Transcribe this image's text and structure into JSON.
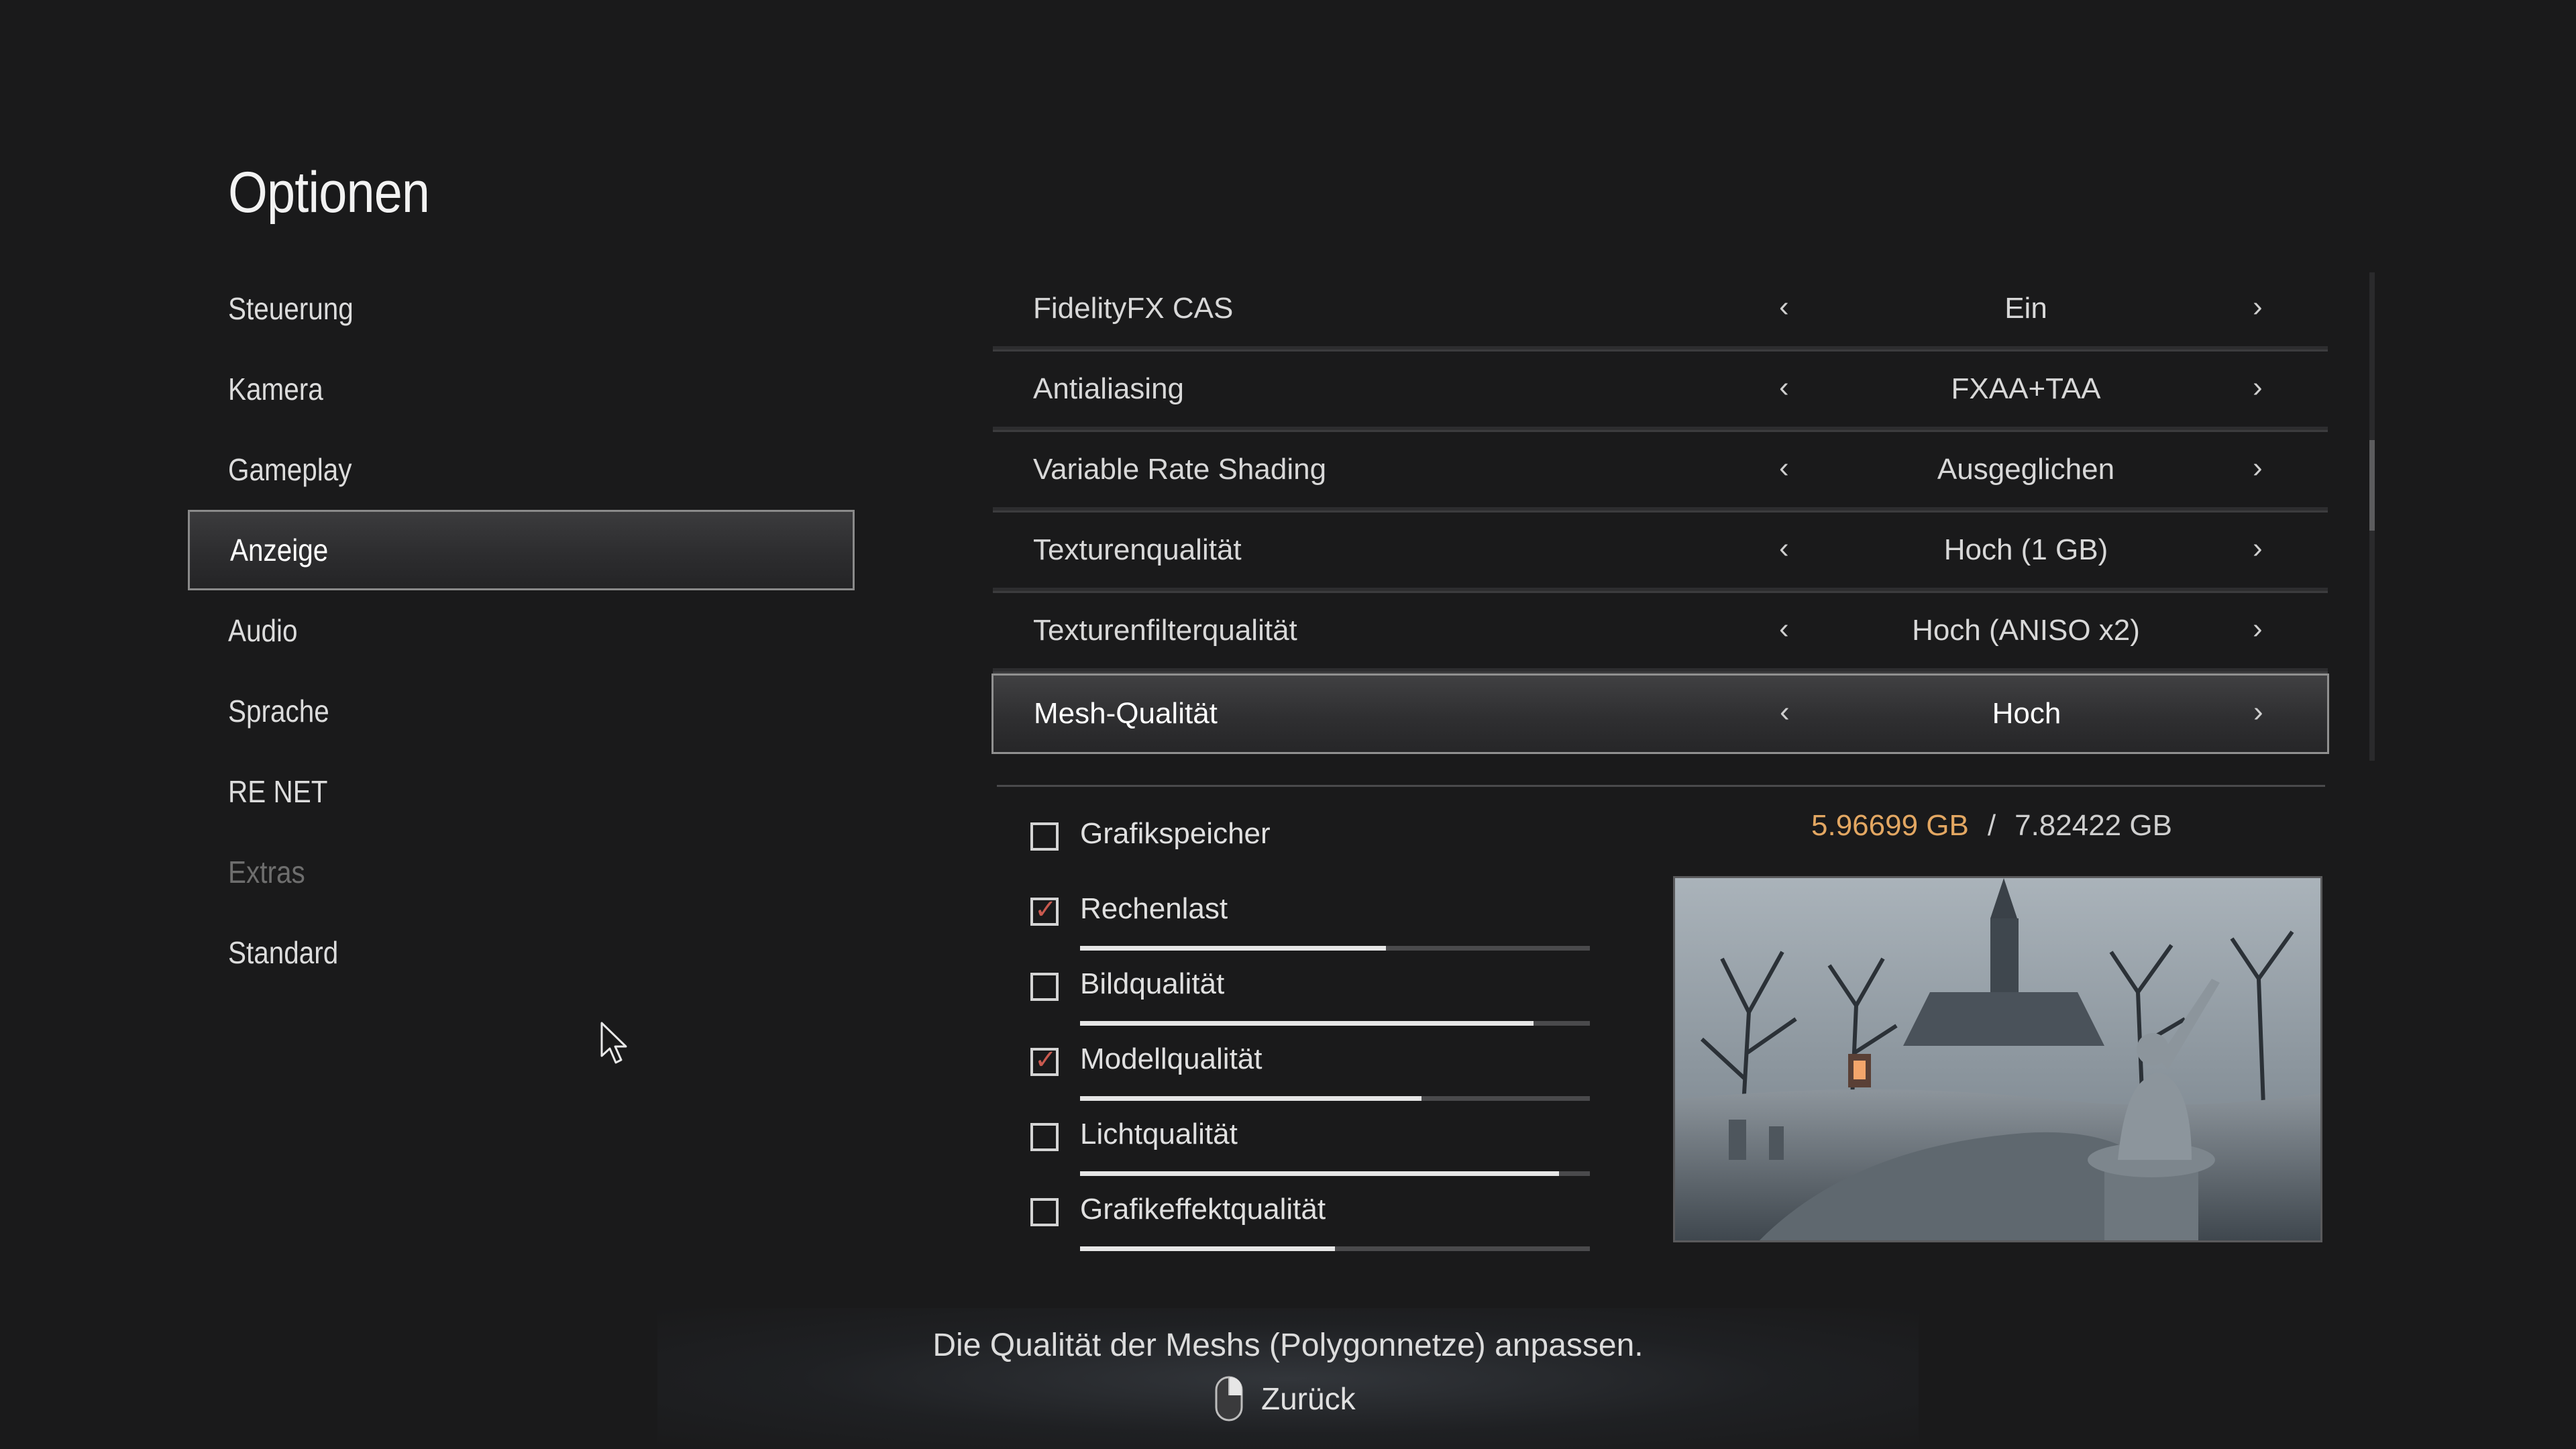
{
  "title": "Optionen",
  "menu": [
    {
      "label": "Steuerung",
      "state": "normal"
    },
    {
      "label": "Kamera",
      "state": "normal"
    },
    {
      "label": "Gameplay",
      "state": "normal"
    },
    {
      "label": "Anzeige",
      "state": "active"
    },
    {
      "label": "Audio",
      "state": "normal"
    },
    {
      "label": "Sprache",
      "state": "normal"
    },
    {
      "label": "RE NET",
      "state": "normal"
    },
    {
      "label": "Extras",
      "state": "disabled"
    },
    {
      "label": "Standard",
      "state": "normal"
    }
  ],
  "settings": [
    {
      "label": "FidelityFX CAS",
      "value": "Ein"
    },
    {
      "label": "Antialiasing",
      "value": "FXAA+TAA"
    },
    {
      "label": "Variable Rate Shading",
      "value": "Ausgeglichen"
    },
    {
      "label": "Texturenqualität",
      "value": "Hoch (1 GB)"
    },
    {
      "label": "Texturenfilterqualität",
      "value": "Hoch (ANISO x2)"
    },
    {
      "label": "Mesh-Qualität",
      "value": "Hoch",
      "active": true
    }
  ],
  "arrows": {
    "left": "‹",
    "right": "›"
  },
  "scrollbar": {
    "position": 0.34
  },
  "vram": {
    "label": "Grafikspeicher",
    "used": "5.96699 GB",
    "separator": "/",
    "total": "7.82422 GB",
    "checked": false
  },
  "metrics": [
    {
      "label": "Rechenlast",
      "checked": true,
      "level": 0.6
    },
    {
      "label": "Bildqualität",
      "checked": false,
      "level": 0.89
    },
    {
      "label": "Modellqualität",
      "checked": true,
      "level": 0.67
    },
    {
      "label": "Lichtqualität",
      "checked": false,
      "level": 0.94
    },
    {
      "label": "Grafikeffektqualität",
      "checked": false,
      "level": 0.5
    }
  ],
  "check_mark": "✓",
  "help": {
    "description": "Die Qualität der Meshs (Polygonnetze) anpassen.",
    "back_label": "Zurück"
  },
  "icons": {
    "back": "mouse-icon",
    "pointer": "cursor-arrow-icon"
  },
  "colors": {
    "accent_vram": "#e3a762",
    "check_tick": "#c95a4f",
    "background": "#1a1a1b"
  }
}
